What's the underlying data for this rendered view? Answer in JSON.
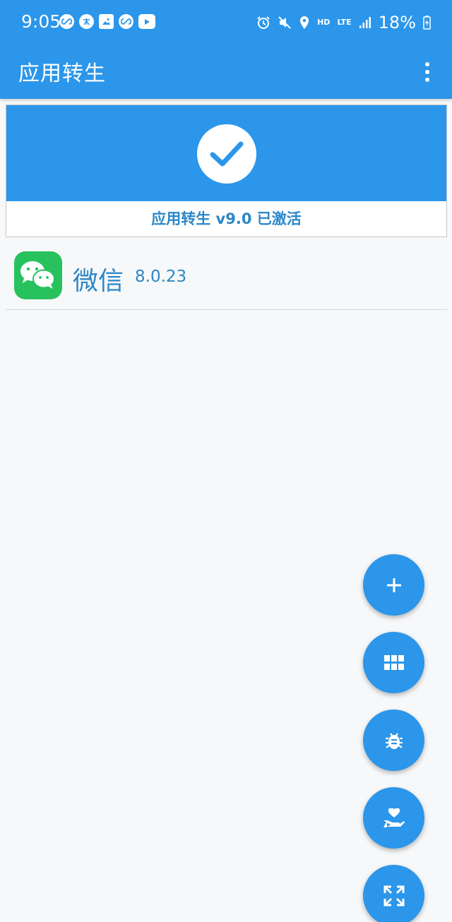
{
  "status_bar": {
    "time": "9:05",
    "network_hd": "HD",
    "network_lte": "LTE",
    "battery": "18%",
    "left_icons": [
      "link-icon",
      "zhihu-icon",
      "image-icon",
      "link-icon",
      "youtube-icon"
    ],
    "right_icons": [
      "alarm-icon",
      "mute-icon",
      "location-icon",
      "signal-icon",
      "battery-charging-icon"
    ]
  },
  "app_bar": {
    "title": "应用转生",
    "menu_icon": "more-vert-icon"
  },
  "activation": {
    "icon": "check-circle-icon",
    "text": "应用转生 v9.0 已激活"
  },
  "apps": [
    {
      "name": "微信",
      "version": "8.0.23",
      "icon": "wechat-icon"
    }
  ],
  "fab_icons": [
    "plus-icon",
    "grid-icon",
    "bug-icon",
    "donate-heart-icon",
    "expand-icon"
  ],
  "colors": {
    "primary": "#2b96ea",
    "text_accent": "#2b87c8",
    "wechat_green": "#27c25d",
    "background": "#f7f8f9"
  }
}
